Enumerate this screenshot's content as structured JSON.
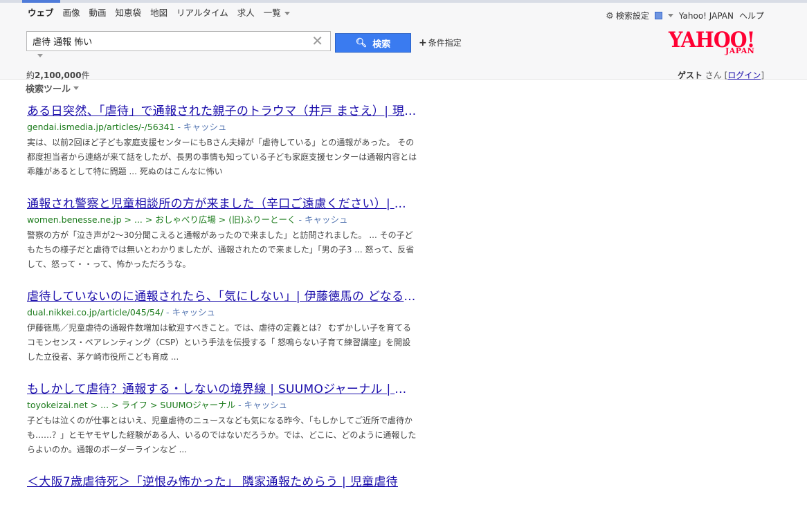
{
  "nav": {
    "tabs": [
      "ウェブ",
      "画像",
      "動画",
      "知恵袋",
      "地図",
      "リアルタイム",
      "求人"
    ],
    "more": "一覧"
  },
  "toplinks": {
    "settings": "検索設定",
    "yahoo_japan": "Yahoo! JAPAN",
    "help": "ヘルプ"
  },
  "search": {
    "query": "虐待 通報 怖い",
    "button": "検索",
    "advanced": "条件指定"
  },
  "logo": {
    "main": "YAHOO!",
    "sub": "JAPAN"
  },
  "stats": {
    "prefix": "約",
    "count": "2,100,000",
    "suffix": "件"
  },
  "user": {
    "guest": "ゲスト",
    "san": " さん [",
    "login": "ログイン",
    "close": "]"
  },
  "tools": "検索ツール",
  "results": [
    {
      "title": "ある日突然、「虐待」で通報された親子のトラウマ（井戸 まさえ）| 現代ビジネス",
      "url": "gendai.ismedia.jp/articles/-/56341",
      "cache": " - キャッシュ",
      "snippet": "実は、以前2回ほど子ども家庭支援センターにもBさん夫婦が「虐待している」との通報があった。 その都度担当者から連絡が来て話をしたが、長男の事情も知っている子ども家庭支援センターは通報内容とは乖離があるとして特に問題 ... 死ぬのはこんなに怖い"
    },
    {
      "title": "通報され警察と児童相談所の方が来ました（辛口ご遠慮ください）| おしゃべり広場",
      "url": "women.benesse.ne.jp > ... > おしゃべり広場 > (旧)ふりーとーく",
      "cache": " - キャッシュ",
      "snippet": "警察の方が「泣き声が2～30分聞こえると通報があったので来ました」と訪問されました。 ... その子どもたちの様子だと虐待では無いとわかりましたが、通報されたので来ました」「男の子3 ... 怒って、反省して、怒って・・って、怖かっただろうな。"
    },
    {
      "title": "虐待していないのに通報されたら、「気にしない」| 伊藤徳馬の どなる子育てから卒業",
      "url": "dual.nikkei.co.jp/article/045/54/",
      "cache": " - キャッシュ",
      "snippet": "伊藤徳馬／児童虐待の通報件数増加は歓迎すべきこと。では、虐待の定義とは？ むずかしい子を育てるコモンセンス・ペアレンティング（CSP）という手法を伝授する「 怒鳴らない子育て練習講座」を開設した立役者、茅ケ崎市役所こども育成 ..."
    },
    {
      "title": "もしかして虐待？通報する・しないの境界線 | SUUMOジャーナル | 住まい",
      "url": "toyokeizai.net > ... > ライフ > SUUMOジャーナル",
      "cache": " - キャッシュ",
      "snippet": "子どもは泣くのが仕事とはいえ、児童虐待のニュースなども気になる昨今、「もしかしてご近所で虐待かも……？」とモヤモヤした経験がある人、いるのではないだろうか。では、どこに、どのように通報したらよいのか。通報のボーダーラインなど ..."
    },
    {
      "title": "＜大阪7歳虐待死＞「逆恨み怖かった」 隣家通報ためらう | 児童虐待",
      "url": "",
      "cache": "",
      "snippet": ""
    }
  ]
}
